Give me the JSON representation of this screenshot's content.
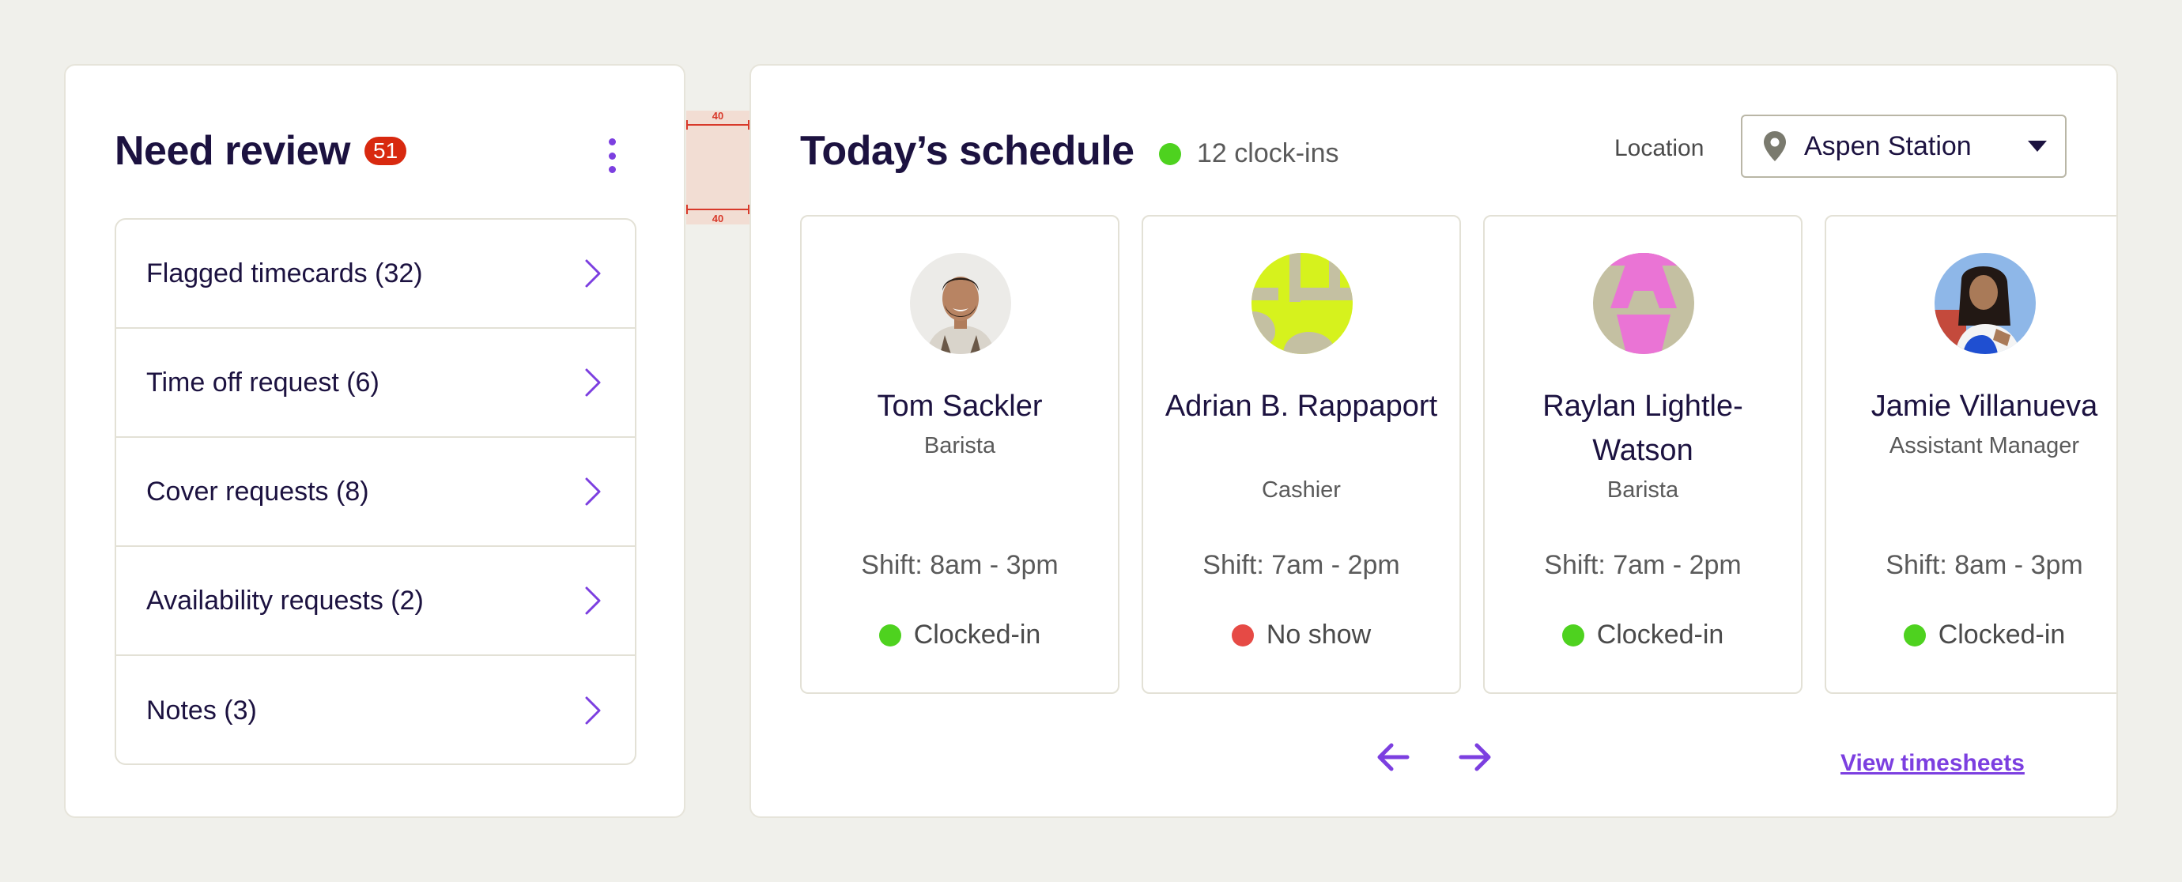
{
  "review": {
    "title": "Need review",
    "badge_count": "51",
    "items": [
      {
        "label": "Flagged timecards (32)"
      },
      {
        "label": "Time off request (6)"
      },
      {
        "label": "Cover requests (8)"
      },
      {
        "label": "Availability requests (2)"
      },
      {
        "label": "Notes (3)"
      }
    ]
  },
  "annotation": {
    "spacing_top": "40",
    "spacing_bottom": "40"
  },
  "schedule": {
    "title": "Today’s schedule",
    "clockins": "12 clock-ins",
    "location_label": "Location",
    "location_value": "Aspen Station",
    "view_link": "View timesheets",
    "employees": [
      {
        "name": "Tom Sackler",
        "role": "Barista",
        "shift": "Shift: 8am - 3pm",
        "status": "Clocked-in",
        "status_color": "#4ed21f"
      },
      {
        "name": "Adrian B. Rappaport",
        "role": "Cashier",
        "shift": "Shift: 7am - 2pm",
        "status": "No show",
        "status_color": "#e64a45"
      },
      {
        "name": "Raylan Lightle-Watson",
        "role": "Barista",
        "shift": "Shift: 7am - 2pm",
        "status": "Clocked-in",
        "status_color": "#4ed21f"
      },
      {
        "name": "Jamie Villanueva",
        "role": "Assistant Manager",
        "shift": "Shift: 8am - 3pm",
        "status": "Clocked-in",
        "status_color": "#4ed21f"
      }
    ]
  },
  "colors": {
    "accent": "#7c3fe0",
    "badge": "#d8290f",
    "status_green": "#4ed21f",
    "status_red": "#e64a45"
  }
}
